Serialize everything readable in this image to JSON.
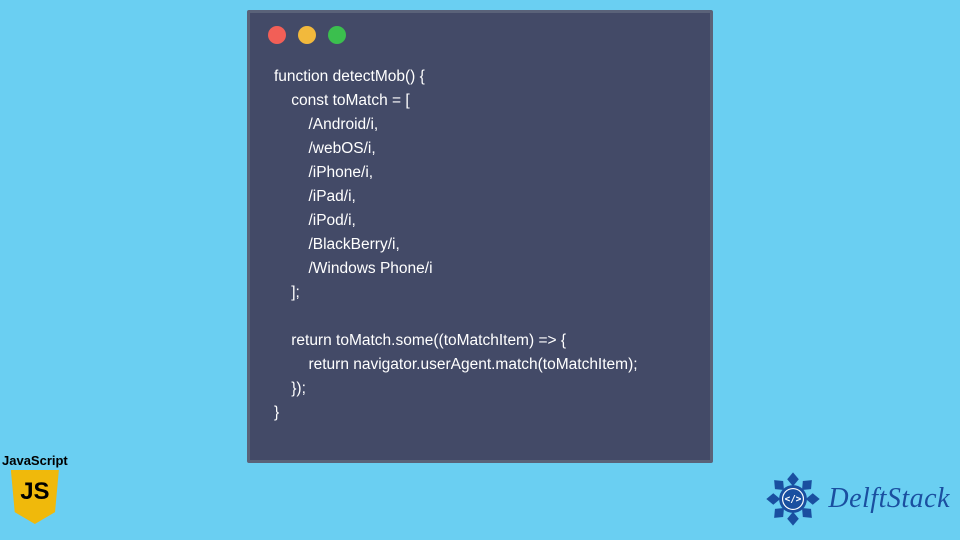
{
  "code_window": {
    "lines": [
      "function detectMob() {",
      "    const toMatch = [",
      "        /Android/i,",
      "        /webOS/i,",
      "        /iPhone/i,",
      "        /iPad/i,",
      "        /iPod/i,",
      "        /BlackBerry/i,",
      "        /Windows Phone/i",
      "    ];",
      "",
      "    return toMatch.some((toMatchItem) => {",
      "        return navigator.userAgent.match(toMatchItem);",
      "    });",
      "}"
    ]
  },
  "js_badge": {
    "label": "JavaScript",
    "shield_text": "JS"
  },
  "delft": {
    "text": "DelftStack"
  },
  "colors": {
    "background": "#6acff2",
    "window_bg": "#434a67",
    "window_border": "#5a6279",
    "code_text": "#ffffff",
    "js_yellow": "#f0b90b",
    "delft_blue": "#1a4fa0"
  }
}
